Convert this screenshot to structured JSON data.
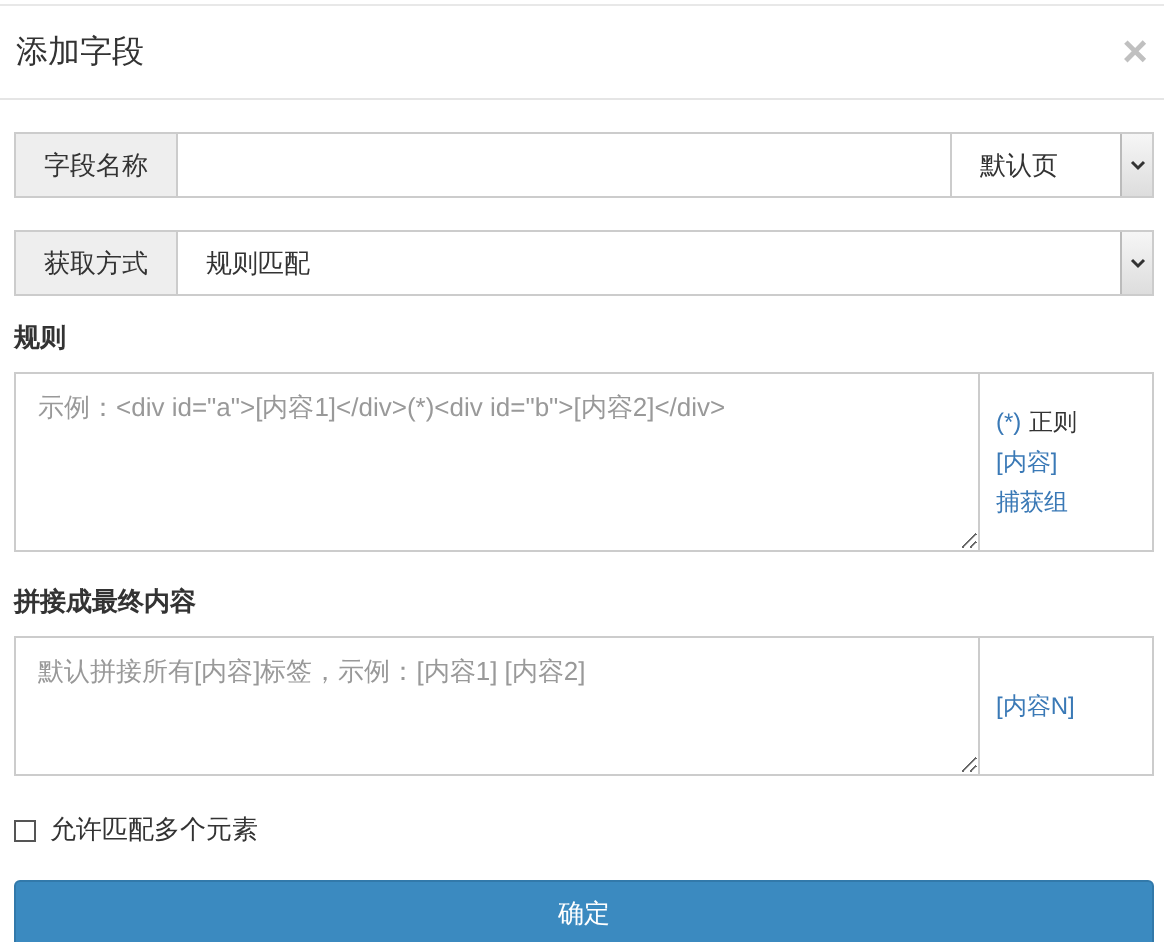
{
  "dialog": {
    "title": "添加字段",
    "close": "×"
  },
  "field_name": {
    "label": "字段名称",
    "page_select": "默认页"
  },
  "fetch_method": {
    "label": "获取方式",
    "value": "规则匹配"
  },
  "rule": {
    "label": "规则",
    "placeholder": "示例：<div id=\"a\">[内容1]</div>(*)<div id=\"b\">[内容2]</div>",
    "hint_lines": [
      [
        {
          "text": "(*)",
          "kind": "link"
        },
        {
          "text": "正则",
          "kind": "plain"
        }
      ],
      [
        {
          "text": "[内容]",
          "kind": "link"
        }
      ],
      [
        {
          "text": "捕获组",
          "kind": "link"
        }
      ]
    ]
  },
  "concat": {
    "label": "拼接成最终内容",
    "placeholder": "默认拼接所有[内容]标签，示例：[内容1] [内容2]",
    "hint_lines": [
      [
        {
          "text": "[内容N]",
          "kind": "link"
        }
      ]
    ]
  },
  "allow_multiple": {
    "label": "允许匹配多个元素",
    "checked": false
  },
  "buttons": [
    "确定"
  ]
}
